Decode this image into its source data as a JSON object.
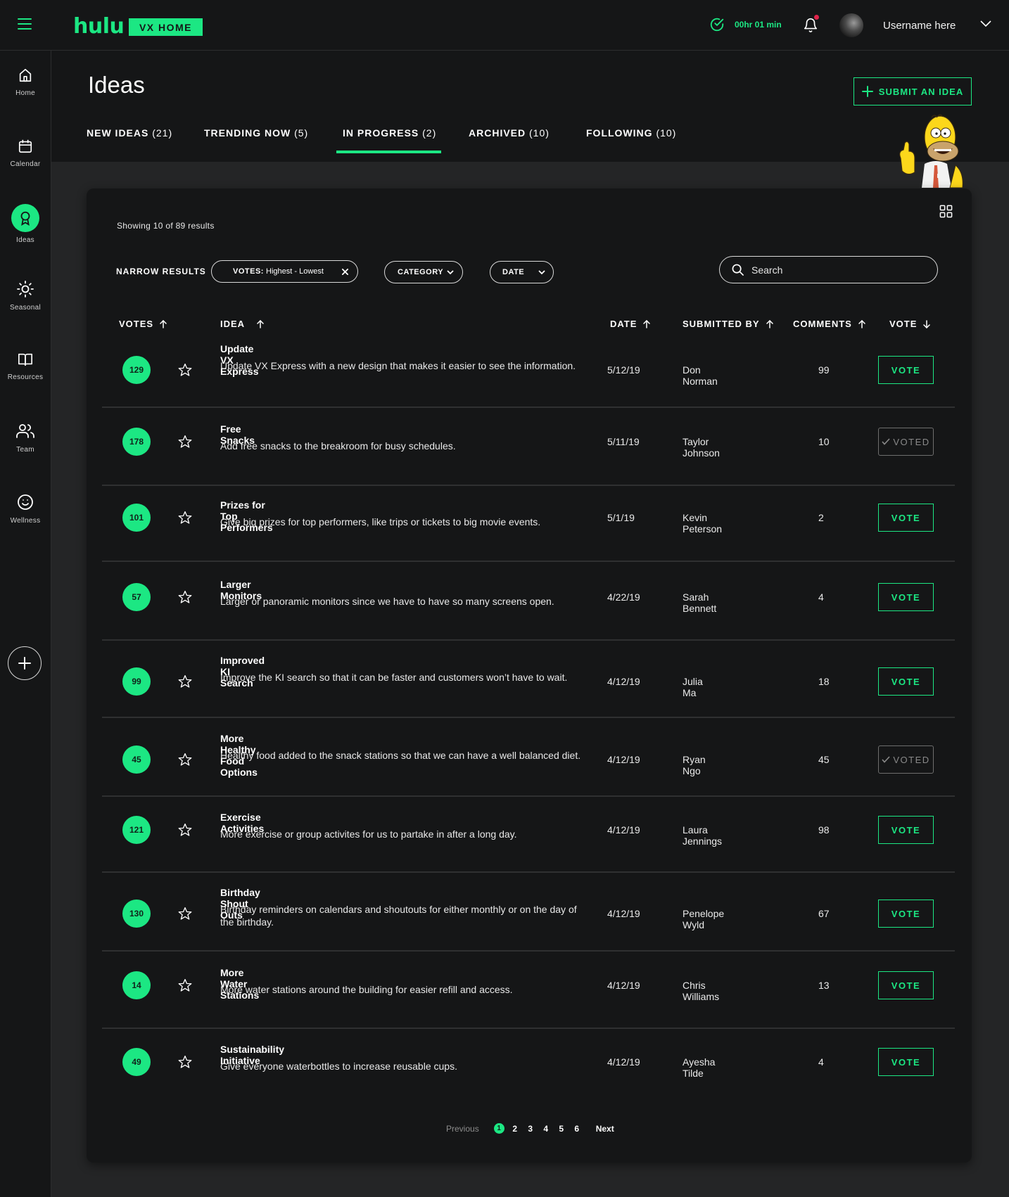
{
  "app": {
    "logo": "hulu",
    "badge": "VX HOME",
    "timer": "00hr 01 min",
    "username": "Username here"
  },
  "sidebar": {
    "items": [
      {
        "label": "Home",
        "icon": "home-icon"
      },
      {
        "label": "Calendar",
        "icon": "calendar-icon"
      },
      {
        "label": "Ideas",
        "icon": "award-icon",
        "active": true
      },
      {
        "label": "Seasonal",
        "icon": "sun-icon"
      },
      {
        "label": "Resources",
        "icon": "book-icon"
      },
      {
        "label": "Team",
        "icon": "team-icon"
      },
      {
        "label": "Wellness",
        "icon": "smiley-icon"
      }
    ]
  },
  "page": {
    "title": "Ideas",
    "submit_label": "SUBMIT AN IDEA",
    "tabs": [
      {
        "label": "NEW IDEAS",
        "count": "(21)"
      },
      {
        "label": "TRENDING NOW",
        "count": "(5)"
      },
      {
        "label": "IN PROGRESS",
        "count": "(2)",
        "active": true
      },
      {
        "label": "ARCHIVED",
        "count": "(10)"
      },
      {
        "label": "FOLLOWING",
        "count": "(10)"
      }
    ]
  },
  "results": {
    "showing": "Showing 10 of 89 results",
    "narrow_label": "NARROW RESULTS",
    "filters": {
      "votes_key": "VOTES:",
      "votes_value": "Highest - Lowest",
      "category": "CATEGORY",
      "date": "DATE"
    },
    "search_placeholder": "Search"
  },
  "table": {
    "headers": {
      "votes": "VOTES",
      "idea": "IDEA",
      "date": "DATE",
      "submitted_by": "SUBMITTED BY",
      "comments": "COMMENTS",
      "vote": "VOTE"
    },
    "rows": [
      {
        "votes": "129",
        "title": "Update VX Express",
        "desc": "Update VX Express with a new design that makes it easier to see the information.",
        "date": "5/12/19",
        "by": "Don Norman",
        "comments": "99",
        "action": "VOTE",
        "voted": false
      },
      {
        "votes": "178",
        "title": "Free Snacks",
        "desc": "Add free snacks to the breakroom for busy schedules.",
        "date": "5/11/19",
        "by": "Taylor Johnson",
        "comments": "10",
        "action": "VOTED",
        "voted": true
      },
      {
        "votes": "101",
        "title": "Prizes for Top Performers",
        "desc": "Give big prizes for top performers, like trips or tickets to big movie events.",
        "date": "5/1/19",
        "by": "Kevin Peterson",
        "comments": "2",
        "action": "VOTE",
        "voted": false
      },
      {
        "votes": "57",
        "title": "Larger Monitors",
        "desc": "Larger or panoramic monitors since we have to have so many screens open.",
        "date": "4/22/19",
        "by": "Sarah Bennett",
        "comments": "4",
        "action": "VOTE",
        "voted": false
      },
      {
        "votes": "99",
        "title": "Improved KI Search",
        "desc": "Improve the KI search so that it can be faster and customers won’t have to wait.",
        "date": "4/12/19",
        "by": "Julia Ma",
        "comments": "18",
        "action": "VOTE",
        "voted": false
      },
      {
        "votes": "45",
        "title": "More Healthy Food Options",
        "desc": "Healthy food added to the snack stations so that we can have a well balanced diet.",
        "date": "4/12/19",
        "by": "Ryan Ngo",
        "comments": "45",
        "action": "VOTED",
        "voted": true
      },
      {
        "votes": "121",
        "title": "Exercise Activities",
        "desc": "More exercise or group activites for us to partake in after a long day.",
        "date": "4/12/19",
        "by": "Laura Jennings",
        "comments": "98",
        "action": "VOTE",
        "voted": false
      },
      {
        "votes": "130",
        "title": "Birthday Shout Outs",
        "desc": "Birthday reminders on calendars and shoutouts for either monthly or on the day of the birthday.",
        "date": "4/12/19",
        "by": "Penelope Wyld",
        "comments": "67",
        "action": "VOTE",
        "voted": false
      },
      {
        "votes": "14",
        "title": "More Water Stations",
        "desc": "More water stations around the building for easier refill and access.",
        "date": "4/12/19",
        "by": "Chris Williams",
        "comments": "13",
        "action": "VOTE",
        "voted": false
      },
      {
        "votes": "49",
        "title": "Sustainability Initiative",
        "desc": "Give everyone waterbottles to increase reusable cups.",
        "date": "4/12/19",
        "by": "Ayesha Tilde",
        "comments": "4",
        "action": "VOTE",
        "voted": false
      }
    ]
  },
  "pagination": {
    "previous": "Previous",
    "pages": [
      "1",
      "2",
      "3",
      "4",
      "5",
      "6"
    ],
    "current": "1",
    "next": "Next"
  },
  "colors": {
    "accent": "#1ce783",
    "background": "#242526",
    "surface": "#151617",
    "notification": "#e0244b"
  }
}
